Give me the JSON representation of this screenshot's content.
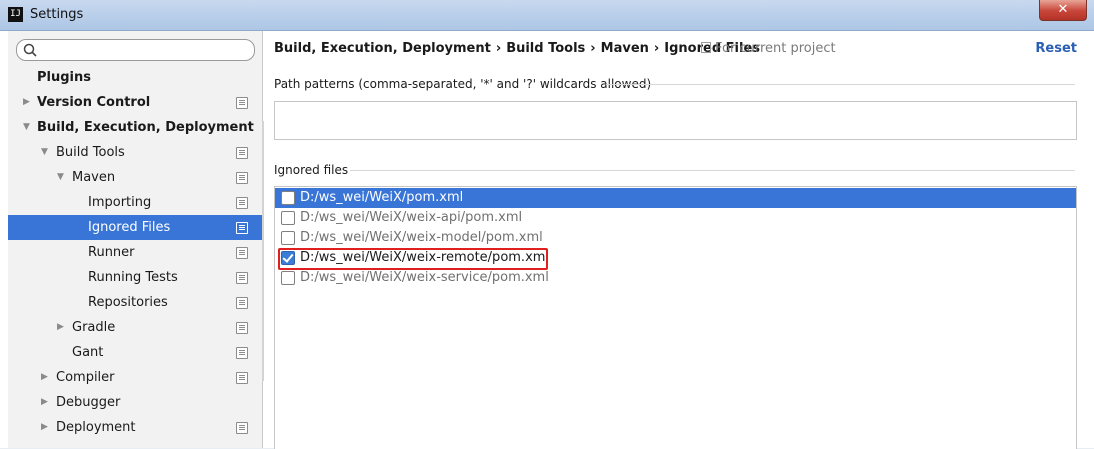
{
  "window": {
    "title": "Settings",
    "app_icon_text": "IJ",
    "close_glyph": "✕"
  },
  "sidebar": {
    "search_placeholder": "",
    "items": [
      {
        "label": "Plugins",
        "level": 0,
        "bold": true,
        "arrow": "",
        "project_icon": false,
        "selected": false
      },
      {
        "label": "Version Control",
        "level": 0,
        "bold": true,
        "arrow": "▶",
        "project_icon": true,
        "selected": false
      },
      {
        "label": "Build, Execution, Deployment",
        "level": 0,
        "bold": true,
        "arrow": "▼",
        "project_icon": false,
        "selected": false
      },
      {
        "label": "Build Tools",
        "level": 1,
        "bold": false,
        "arrow": "▼",
        "project_icon": true,
        "selected": false
      },
      {
        "label": "Maven",
        "level": 2,
        "bold": false,
        "arrow": "▼",
        "project_icon": true,
        "selected": false
      },
      {
        "label": "Importing",
        "level": 3,
        "bold": false,
        "arrow": "",
        "project_icon": true,
        "selected": false
      },
      {
        "label": "Ignored Files",
        "level": 3,
        "bold": false,
        "arrow": "",
        "project_icon": true,
        "selected": true
      },
      {
        "label": "Runner",
        "level": 3,
        "bold": false,
        "arrow": "",
        "project_icon": true,
        "selected": false
      },
      {
        "label": "Running Tests",
        "level": 3,
        "bold": false,
        "arrow": "",
        "project_icon": true,
        "selected": false
      },
      {
        "label": "Repositories",
        "level": 3,
        "bold": false,
        "arrow": "",
        "project_icon": true,
        "selected": false
      },
      {
        "label": "Gradle",
        "level": 2,
        "bold": false,
        "arrow": "▶",
        "project_icon": true,
        "selected": false
      },
      {
        "label": "Gant",
        "level": 2,
        "bold": false,
        "arrow": "",
        "project_icon": true,
        "selected": false
      },
      {
        "label": "Compiler",
        "level": 1,
        "bold": false,
        "arrow": "▶",
        "project_icon": true,
        "selected": false
      },
      {
        "label": "Debugger",
        "level": 1,
        "bold": false,
        "arrow": "▶",
        "project_icon": false,
        "selected": false
      },
      {
        "label": "Deployment",
        "level": 1,
        "bold": false,
        "arrow": "▶",
        "project_icon": true,
        "selected": false
      }
    ]
  },
  "breadcrumb": {
    "parts": [
      "Build, Execution, Deployment",
      "Build Tools",
      "Maven",
      "Ignored Files"
    ],
    "separator": "›",
    "scope": "For current project",
    "reset_label": "Reset"
  },
  "patterns": {
    "label": "Path patterns (comma-separated, '*' and '?' wildcards allowed)",
    "value": ""
  },
  "ignored_files": {
    "label": "Ignored files",
    "rows": [
      {
        "path": "D:/ws_wei/WeiX/pom.xml",
        "checked": false,
        "selected": true,
        "dim": false
      },
      {
        "path": "D:/ws_wei/WeiX/weix-api/pom.xml",
        "checked": false,
        "selected": false,
        "dim": true
      },
      {
        "path": "D:/ws_wei/WeiX/weix-model/pom.xml",
        "checked": false,
        "selected": false,
        "dim": true
      },
      {
        "path": "D:/ws_wei/WeiX/weix-remote/pom.xml",
        "checked": true,
        "selected": false,
        "dim": false
      },
      {
        "path": "D:/ws_wei/WeiX/weix-service/pom.xml",
        "checked": false,
        "selected": false,
        "dim": true
      }
    ]
  },
  "colors": {
    "selection": "#3875d7",
    "highlight_annotation": "#e02020",
    "link": "#2b5fb3"
  }
}
